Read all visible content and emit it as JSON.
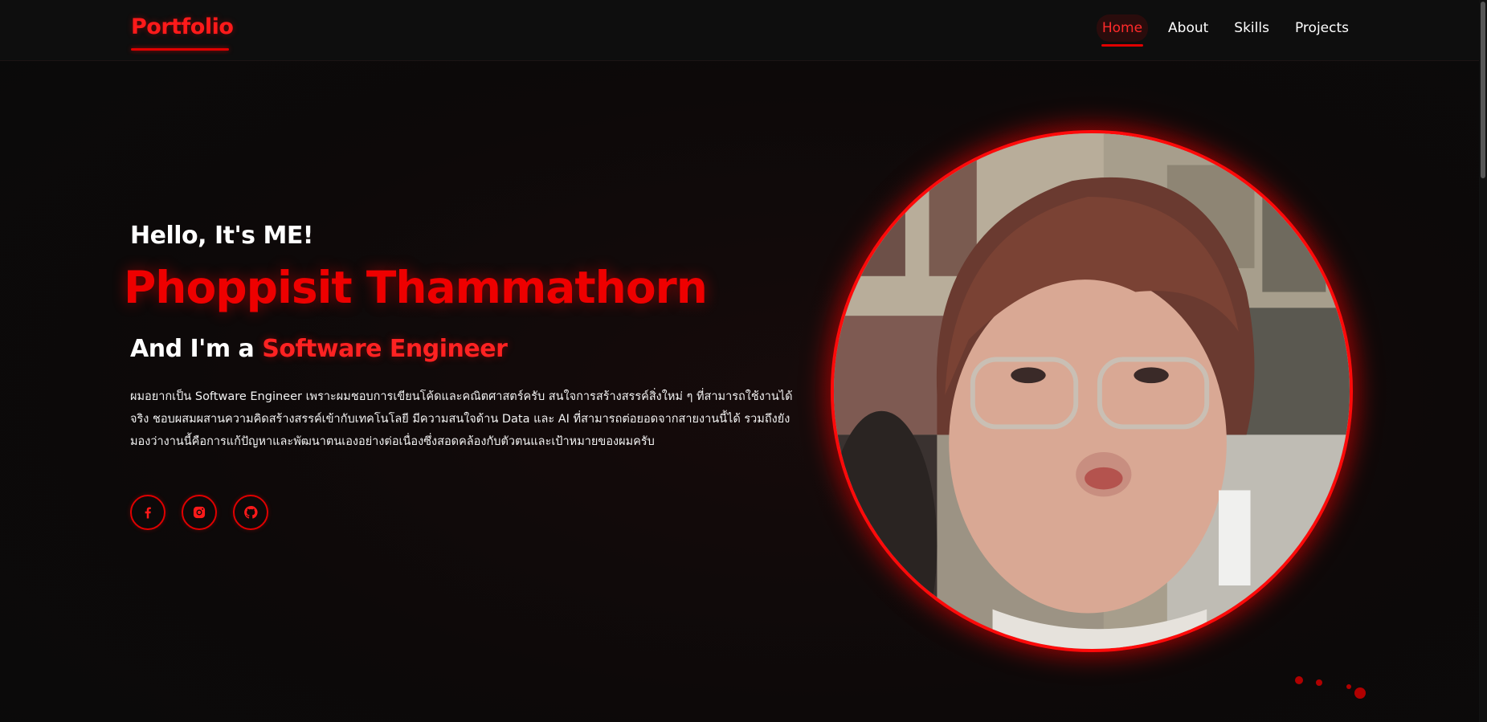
{
  "header": {
    "logo": "Portfolio",
    "nav": [
      {
        "label": "Home",
        "active": true
      },
      {
        "label": "About",
        "active": false
      },
      {
        "label": "Skills",
        "active": false
      },
      {
        "label": "Projects",
        "active": false
      }
    ]
  },
  "hero": {
    "greeting": "Hello, It's ME!",
    "name": "Phoppisit Thammathorn",
    "role_prefix": "And I'm a",
    "role_title": "Software Engineer",
    "bio": "ผมอยากเป็น Software Engineer เพราะผมชอบการเขียนโค้ดและคณิตศาสตร์ครับ สนใจการสร้างสรรค์สิ่งใหม่ ๆ ที่สามารถใช้งานได้จริง ชอบผสมผสานความคิดสร้างสรรค์เข้ากับเทคโนโลยี มีความสนใจด้าน Data และ AI ที่สามารถต่อยอดจากสายงานนี้ได้ รวมถึงยังมองว่างานนี้คือการแก้ปัญหาและพัฒนาตนเองอย่างต่อเนื่องซึ่งสอดคล้องกับตัวตนและเป้าหมายของผมครับ"
  },
  "socials": [
    {
      "icon": "facebook-icon"
    },
    {
      "icon": "instagram-icon"
    },
    {
      "icon": "github-icon"
    }
  ],
  "colors": {
    "accent": "#ff0a0a",
    "background": "#0b0a0a",
    "text": "#ffffff"
  }
}
